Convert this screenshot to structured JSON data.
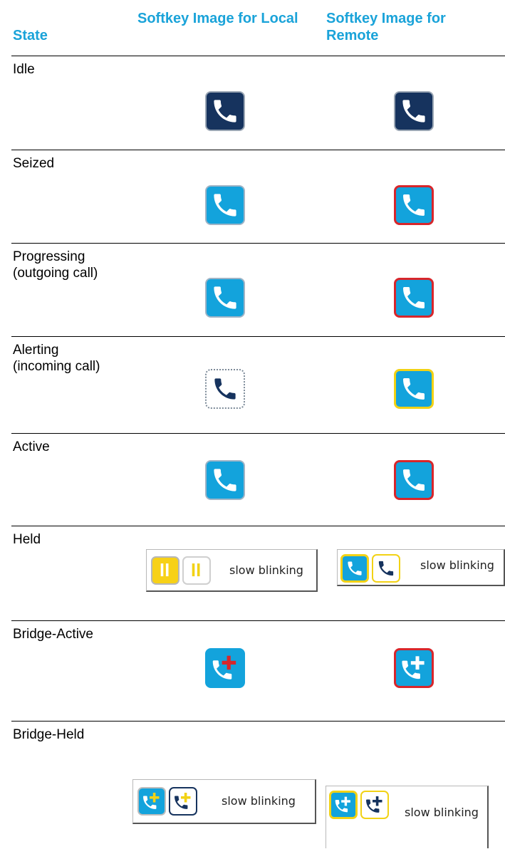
{
  "header": {
    "state": "State",
    "local": "Softkey Image for Local",
    "remote": "Softkey Image for Remote"
  },
  "rows": [
    {
      "state_line1": "Idle",
      "state_line2": "",
      "local_icon": "phone-icon",
      "remote_icon": "phone-icon"
    },
    {
      "state_line1": "Seized",
      "state_line2": "",
      "local_icon": "phone-icon",
      "remote_icon": "phone-icon"
    },
    {
      "state_line1": "Progressing",
      "state_line2": "(outgoing call)",
      "local_icon": "phone-icon",
      "remote_icon": "phone-icon"
    },
    {
      "state_line1": "Alerting",
      "state_line2": "(incoming call)",
      "local_icon": "phone-icon",
      "remote_icon": "phone-icon"
    },
    {
      "state_line1": "Active",
      "state_line2": "",
      "local_icon": "phone-icon",
      "remote_icon": "phone-icon"
    },
    {
      "state_line1": "Held",
      "state_line2": "",
      "local_icon": "pause-icon",
      "remote_icon": "phone-icon",
      "local_note": "slow blinking",
      "remote_note": "slow blinking"
    },
    {
      "state_line1": "Bridge-Active",
      "state_line2": "",
      "local_icon": "phone-plus-icon",
      "remote_icon": "phone-plus-icon"
    },
    {
      "state_line1": "Bridge-Held",
      "state_line2": "",
      "local_icon": "phone-plus-icon",
      "remote_icon": "phone-plus-icon",
      "local_note": "slow blinking",
      "remote_note": "slow blinking"
    }
  ],
  "colors": {
    "header_text": "#1aa3d9",
    "icon_navy": "#16335e",
    "icon_blue": "#13a3dc",
    "remote_border_red": "#d8262b",
    "alert_border_yellow": "#f2d215"
  }
}
